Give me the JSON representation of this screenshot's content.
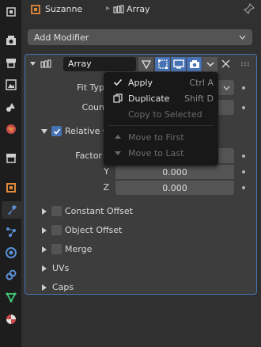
{
  "header": {
    "object_name": "Suzanne",
    "modifier_name": "Array"
  },
  "add_modifier": {
    "label": "Add Modifier"
  },
  "modifier": {
    "name": "Array",
    "fit_type_label": "Fit Typ",
    "count_label": "Coun",
    "relative_offset_label": "Relative O",
    "relative_offset_checked": true,
    "factor": {
      "x_label": "Factor X",
      "y_label": "Y",
      "z_label": "Z",
      "y_value": "0.000",
      "z_value": "0.000"
    },
    "subpanels": [
      {
        "label": "Constant Offset",
        "has_checkbox": true
      },
      {
        "label": "Object Offset",
        "has_checkbox": true
      },
      {
        "label": "Merge",
        "has_checkbox": true
      },
      {
        "label": "UVs",
        "has_checkbox": false
      },
      {
        "label": "Caps",
        "has_checkbox": false
      }
    ]
  },
  "menu": {
    "items": [
      {
        "label": "Apply",
        "shortcut": "Ctrl A",
        "icon": "check-icon",
        "enabled": true
      },
      {
        "label": "Duplicate",
        "shortcut": "Shift D",
        "icon": "duplicate-icon",
        "enabled": true
      },
      {
        "label": "Copy to Selected",
        "shortcut": "",
        "icon": "",
        "enabled": false
      },
      {
        "label": "Move to First",
        "shortcut": "",
        "icon": "triangle-up-icon",
        "enabled": false
      },
      {
        "label": "Move to Last",
        "shortcut": "",
        "icon": "triangle-down-icon",
        "enabled": false
      }
    ]
  },
  "colors": {
    "accent": "#4772b3",
    "background": "#303030",
    "panel": "#3d3d3d",
    "menu": "#181818",
    "tabbar": "#1d1d1d"
  },
  "tabs": [
    "tool-icon",
    "render-icon",
    "output-icon",
    "view-layer-icon",
    "scene-icon",
    "world-icon",
    "collection-icon",
    "object-icon",
    "modifier-icon",
    "particles-icon",
    "physics-icon",
    "constraints-icon",
    "data-icon",
    "material-icon"
  ]
}
